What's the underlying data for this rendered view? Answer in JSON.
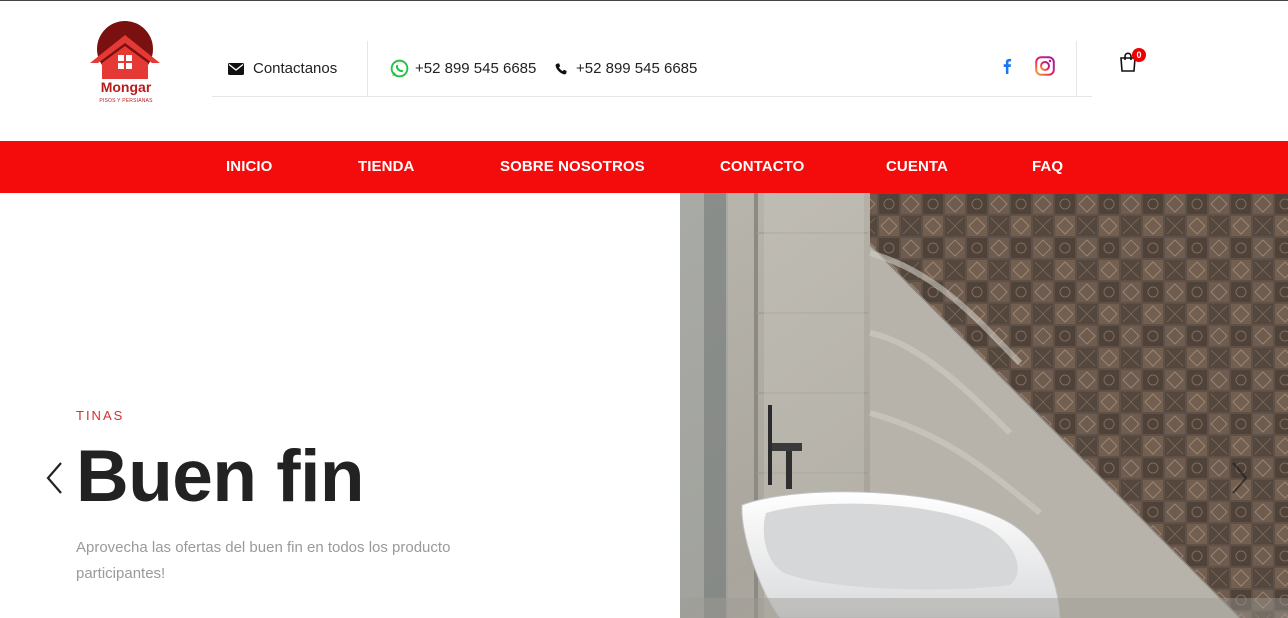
{
  "brand": {
    "name": "Mongar",
    "tagline": "PISOS Y PERSIANAS",
    "color": "#b71c1c"
  },
  "header": {
    "contact_label": "Contactanos",
    "whatsapp_phone": "+52 899 545 6685",
    "phone": "+52 899 545 6685",
    "cart_count": "0",
    "icons": [
      "envelope-icon",
      "whatsapp-icon",
      "phone-icon",
      "facebook-icon",
      "instagram-icon",
      "cart-icon"
    ]
  },
  "nav": {
    "items": [
      {
        "label": "INICIO"
      },
      {
        "label": "TIENDA"
      },
      {
        "label": "SOBRE NOSOTROS"
      },
      {
        "label": "CONTACTO"
      },
      {
        "label": "CUENTA"
      },
      {
        "label": "FAQ"
      }
    ],
    "color": "#f40c0c"
  },
  "hero": {
    "eyebrow": "TINAS",
    "title": "Buen fin",
    "description": "Aprovecha las ofertas del buen fin en todos los producto participantes!",
    "accent": "#d32f2f"
  }
}
